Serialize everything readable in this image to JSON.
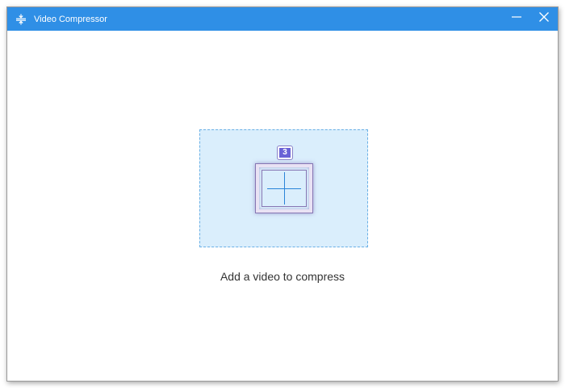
{
  "window": {
    "title": "Video Compressor",
    "app_icon": "compress-icon",
    "controls": {
      "minimize_icon": "minimize-icon",
      "close_icon": "close-icon"
    }
  },
  "dropzone": {
    "badge": "3",
    "icon": "add-file-icon",
    "hint": "Add a video to compress"
  },
  "colors": {
    "titlebar": "#2f8fe6",
    "dropzone_fill": "#daeefc",
    "dropzone_border": "#6ab0e6",
    "badge": "#6a62d6",
    "plus": "#2a84d8"
  }
}
